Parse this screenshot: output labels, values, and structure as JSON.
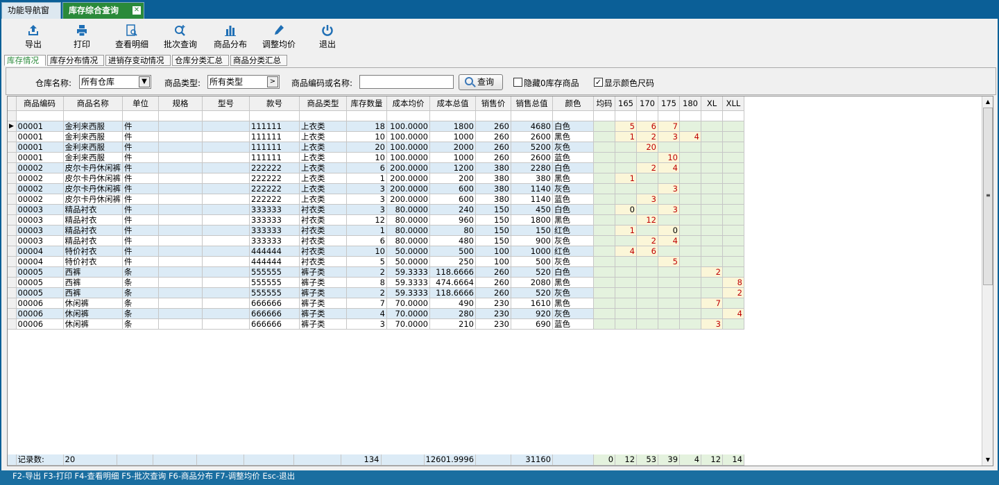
{
  "tabs": [
    {
      "label": "功能导航窗口"
    },
    {
      "label": "库存综合查询"
    }
  ],
  "toolbar": [
    {
      "label": "导出",
      "icon": "export-icon"
    },
    {
      "label": "打印",
      "icon": "print-icon"
    },
    {
      "label": "查看明细",
      "icon": "view-detail-icon"
    },
    {
      "label": "批次查询",
      "icon": "batch-search-icon"
    },
    {
      "label": "商品分布",
      "icon": "bar-chart-icon"
    },
    {
      "label": "调整均价",
      "icon": "pencil-icon"
    },
    {
      "label": "退出",
      "icon": "power-icon"
    }
  ],
  "subtabs": [
    "库存情况",
    "库存分布情况",
    "进销存变动情况",
    "仓库分类汇总",
    "商品分类汇总"
  ],
  "filter": {
    "warehouse_label": "仓库名称:",
    "warehouse_value": "所有仓库",
    "category_label": "商品类型:",
    "category_value": "所有类型",
    "code_label": "商品编码或名称:",
    "code_value": "",
    "query_button": "查询",
    "hide_zero_label": "隐藏0库存商品",
    "hide_zero_checked": false,
    "show_color_label": "显示颜色尺码",
    "show_color_checked": true
  },
  "columns": [
    "商品编码",
    "商品名称",
    "单位",
    "规格",
    "型号",
    "款号",
    "商品类型",
    "库存数量",
    "成本均价",
    "成本总值",
    "销售价",
    "销售总值",
    "颜色",
    "均码",
    "165",
    "170",
    "175",
    "180",
    "XL",
    "XLL"
  ],
  "rows": [
    [
      "00001",
      "金利来西服",
      "件",
      "",
      "",
      "111111",
      "上衣类",
      "18",
      "100.0000",
      "1800",
      "260",
      "4680",
      "白色",
      "",
      "5",
      "6",
      "7",
      "",
      "",
      ""
    ],
    [
      "00001",
      "金利来西服",
      "件",
      "",
      "",
      "111111",
      "上衣类",
      "10",
      "100.0000",
      "1000",
      "260",
      "2600",
      "黑色",
      "",
      "1",
      "2",
      "3",
      "4",
      "",
      ""
    ],
    [
      "00001",
      "金利来西服",
      "件",
      "",
      "",
      "111111",
      "上衣类",
      "20",
      "100.0000",
      "2000",
      "260",
      "5200",
      "灰色",
      "",
      "",
      "20",
      "",
      "",
      "",
      ""
    ],
    [
      "00001",
      "金利来西服",
      "件",
      "",
      "",
      "111111",
      "上衣类",
      "10",
      "100.0000",
      "1000",
      "260",
      "2600",
      "蓝色",
      "",
      "",
      "",
      "10",
      "",
      "",
      ""
    ],
    [
      "00002",
      "皮尔卡丹休闲裤",
      "件",
      "",
      "",
      "222222",
      "上衣类",
      "6",
      "200.0000",
      "1200",
      "380",
      "2280",
      "白色",
      "",
      "",
      "2",
      "4",
      "",
      "",
      ""
    ],
    [
      "00002",
      "皮尔卡丹休闲裤",
      "件",
      "",
      "",
      "222222",
      "上衣类",
      "1",
      "200.0000",
      "200",
      "380",
      "380",
      "黑色",
      "",
      "1",
      "",
      "",
      "",
      "",
      ""
    ],
    [
      "00002",
      "皮尔卡丹休闲裤",
      "件",
      "",
      "",
      "222222",
      "上衣类",
      "3",
      "200.0000",
      "600",
      "380",
      "1140",
      "灰色",
      "",
      "",
      "",
      "3",
      "",
      "",
      ""
    ],
    [
      "00002",
      "皮尔卡丹休闲裤",
      "件",
      "",
      "",
      "222222",
      "上衣类",
      "3",
      "200.0000",
      "600",
      "380",
      "1140",
      "蓝色",
      "",
      "",
      "3",
      "",
      "",
      "",
      ""
    ],
    [
      "00003",
      "精品衬衣",
      "件",
      "",
      "",
      "333333",
      "衬衣类",
      "3",
      "80.0000",
      "240",
      "150",
      "450",
      "白色",
      "",
      "0",
      "",
      "3",
      "",
      "",
      ""
    ],
    [
      "00003",
      "精品衬衣",
      "件",
      "",
      "",
      "333333",
      "衬衣类",
      "12",
      "80.0000",
      "960",
      "150",
      "1800",
      "黑色",
      "",
      "",
      "12",
      "",
      "",
      "",
      ""
    ],
    [
      "00003",
      "精品衬衣",
      "件",
      "",
      "",
      "333333",
      "衬衣类",
      "1",
      "80.0000",
      "80",
      "150",
      "150",
      "红色",
      "",
      "1",
      "",
      "0",
      "",
      "",
      ""
    ],
    [
      "00003",
      "精品衬衣",
      "件",
      "",
      "",
      "333333",
      "衬衣类",
      "6",
      "80.0000",
      "480",
      "150",
      "900",
      "灰色",
      "",
      "",
      "2",
      "4",
      "",
      "",
      ""
    ],
    [
      "00004",
      "特价衬衣",
      "件",
      "",
      "",
      "444444",
      "衬衣类",
      "10",
      "50.0000",
      "500",
      "100",
      "1000",
      "红色",
      "",
      "4",
      "6",
      "",
      "",
      "",
      ""
    ],
    [
      "00004",
      "特价衬衣",
      "件",
      "",
      "",
      "444444",
      "衬衣类",
      "5",
      "50.0000",
      "250",
      "100",
      "500",
      "灰色",
      "",
      "",
      "",
      "5",
      "",
      "",
      ""
    ],
    [
      "00005",
      "西裤",
      "条",
      "",
      "",
      "555555",
      "裤子类",
      "2",
      "59.3333",
      "118.6666",
      "260",
      "520",
      "白色",
      "",
      "",
      "",
      "",
      "",
      "2",
      ""
    ],
    [
      "00005",
      "西裤",
      "条",
      "",
      "",
      "555555",
      "裤子类",
      "8",
      "59.3333",
      "474.6664",
      "260",
      "2080",
      "黑色",
      "",
      "",
      "",
      "",
      "",
      "",
      "8"
    ],
    [
      "00005",
      "西裤",
      "条",
      "",
      "",
      "555555",
      "裤子类",
      "2",
      "59.3333",
      "118.6666",
      "260",
      "520",
      "灰色",
      "",
      "",
      "",
      "",
      "",
      "",
      "2"
    ],
    [
      "00006",
      "休闲裤",
      "条",
      "",
      "",
      "666666",
      "裤子类",
      "7",
      "70.0000",
      "490",
      "230",
      "1610",
      "黑色",
      "",
      "",
      "",
      "",
      "",
      "7",
      ""
    ],
    [
      "00006",
      "休闲裤",
      "条",
      "",
      "",
      "666666",
      "裤子类",
      "4",
      "70.0000",
      "280",
      "230",
      "920",
      "灰色",
      "",
      "",
      "",
      "",
      "",
      "",
      "4"
    ],
    [
      "00006",
      "休闲裤",
      "条",
      "",
      "",
      "666666",
      "裤子类",
      "3",
      "70.0000",
      "210",
      "230",
      "690",
      "蓝色",
      "",
      "",
      "",
      "",
      "",
      "3",
      ""
    ]
  ],
  "summary": [
    "记录数:",
    "20",
    "",
    "",
    "",
    "",
    "",
    "134",
    "",
    "12601.9996",
    "",
    "31160",
    "",
    "0",
    "12",
    "53",
    "39",
    "4",
    "12",
    "14"
  ],
  "statusbar": "F2-导出 F3-打印 F4-查看明细 F5-批次查询 F6-商品分布 F7-调整均价 Esc-退出"
}
